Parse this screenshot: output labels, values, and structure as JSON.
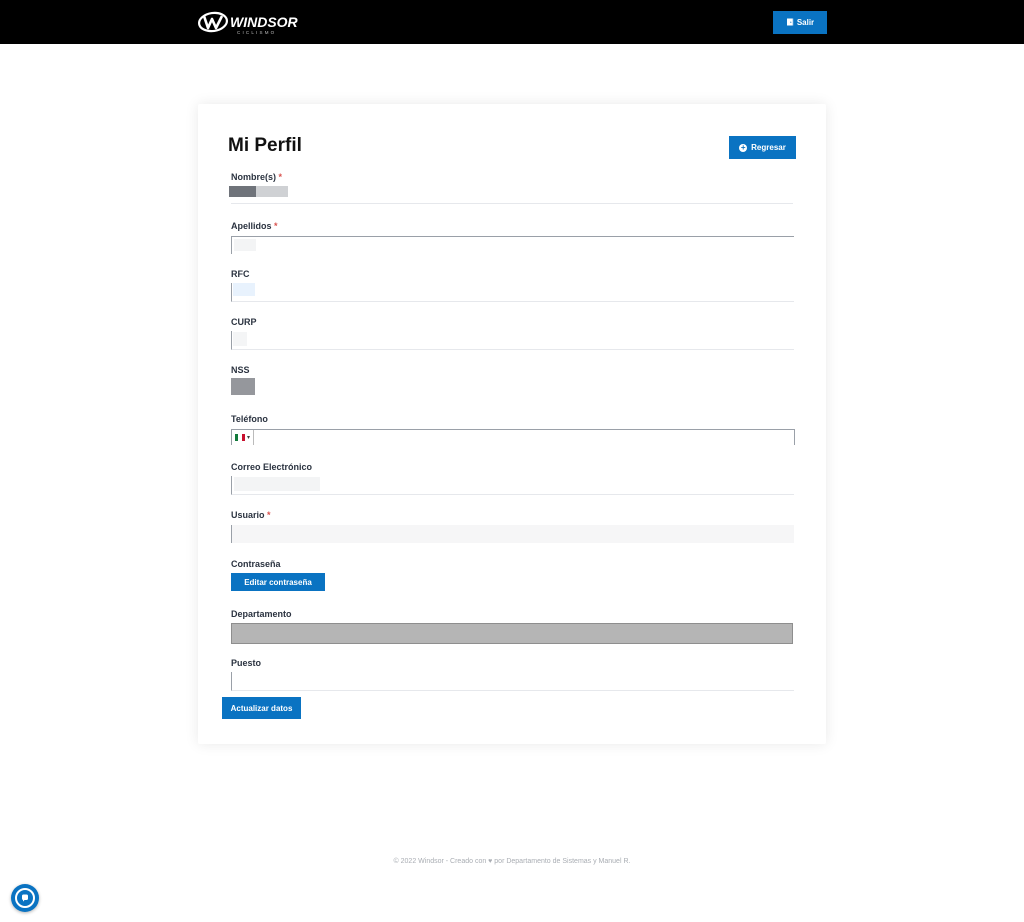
{
  "header": {
    "logo_text": "WINDSOR",
    "logo_subtext": "CICLISMO",
    "logout_label": "Salir"
  },
  "profile": {
    "title": "Mi Perfil",
    "back_label": "Regresar",
    "fields": {
      "nombre": {
        "label": "Nombre(s)",
        "required_mark": "*"
      },
      "apellidos": {
        "label": "Apellidos",
        "required_mark": "*"
      },
      "rfc": {
        "label": "RFC"
      },
      "curp": {
        "label": "CURP"
      },
      "nss": {
        "label": "NSS"
      },
      "telefono": {
        "label": "Teléfono"
      },
      "correo": {
        "label": "Correo Electrónico"
      },
      "usuario": {
        "label": "Usuario",
        "required_mark": "*"
      },
      "contrasena": {
        "label": "Contraseña",
        "edit_label": "Editar contraseña"
      },
      "departamento": {
        "label": "Departamento"
      },
      "puesto": {
        "label": "Puesto"
      }
    },
    "submit_label": "Actualizar datos"
  },
  "footer": {
    "text": "© 2022 Windsor - Creado con ♥ por Departamento de Sistemas y Manuel R."
  },
  "colors": {
    "accent": "#0a73c2",
    "header_bg": "#000000",
    "required": "#d9534f"
  },
  "icons": {
    "logout": "door-icon",
    "back": "plus-circle-icon",
    "chat": "chat-bubble-icon"
  }
}
